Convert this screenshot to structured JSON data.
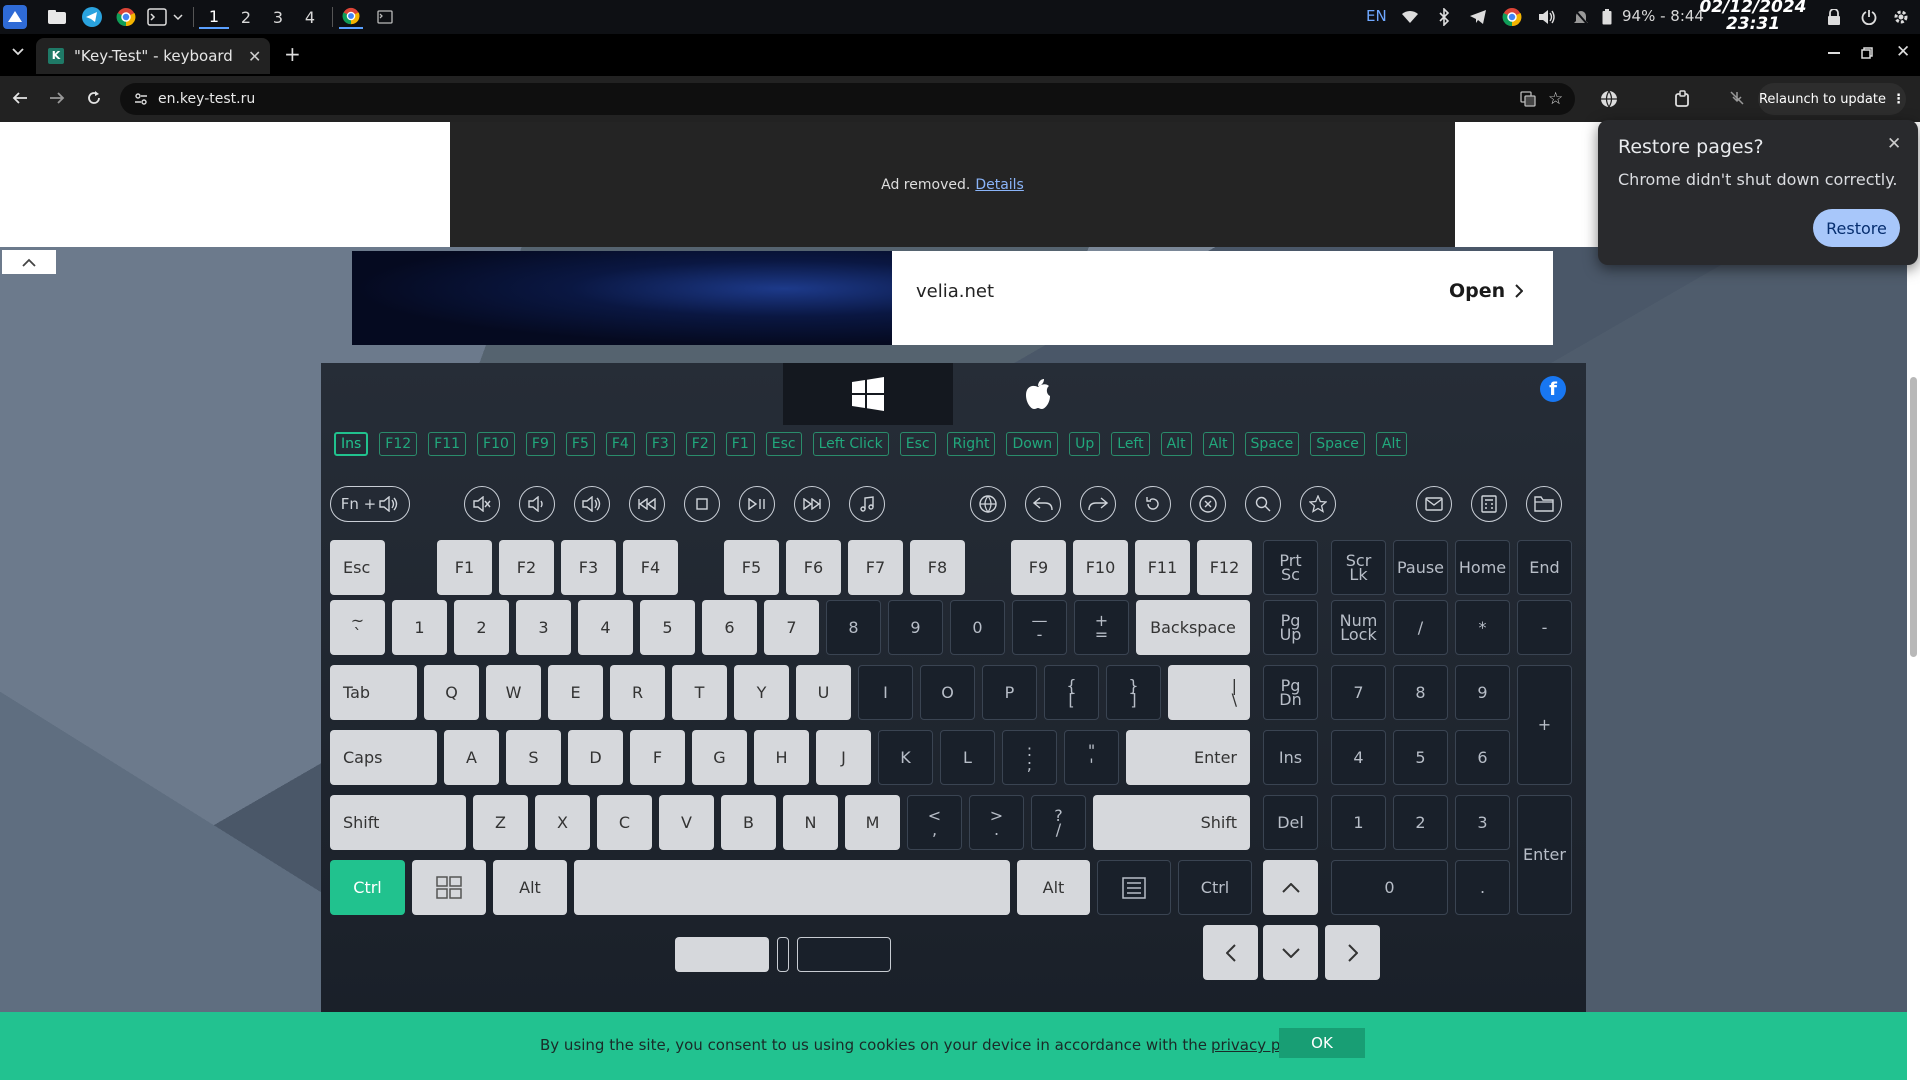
{
  "system_bar": {
    "workspaces": [
      "1",
      "2",
      "3",
      "4"
    ],
    "active_workspace": "1",
    "language": "EN",
    "battery": "94% - 8:44",
    "date": "02/12/2024",
    "time": "23:31"
  },
  "browser": {
    "tab_title": "\"Key-Test\" - keyboard te",
    "tab_favicon_letter": "K",
    "url": "en.key-test.ru",
    "relaunch_label": "Relaunch to update"
  },
  "ad": {
    "removed_text": "Ad removed.",
    "details_link": "Details"
  },
  "banner": {
    "site": "velia.net",
    "open_label": "Open"
  },
  "restore_popup": {
    "title": "Restore pages?",
    "message": "Chrome didn't shut down correctly.",
    "button": "Restore"
  },
  "keyboard": {
    "facebook_letter": "f",
    "history": [
      "Ins",
      "F12",
      "F11",
      "F10",
      "F9",
      "F5",
      "F4",
      "F3",
      "F2",
      "F1",
      "Esc",
      "Left Click",
      "Esc",
      "Right",
      "Down",
      "Up",
      "Left",
      "Alt",
      "Alt",
      "Space",
      "Space",
      "Alt"
    ],
    "fn_label": "Fn +",
    "rows": {
      "esc": "Esc",
      "f": [
        "F1",
        "F2",
        "F3",
        "F4",
        "F5",
        "F6",
        "F7",
        "F8",
        "F9",
        "F10",
        "F11",
        "F12"
      ],
      "prtsc": [
        "Prt",
        "Sc"
      ],
      "scrlk": [
        "Scr",
        "Lk"
      ],
      "pause": "Pause",
      "home": "Home",
      "end": "End",
      "num": [
        "1",
        "2",
        "3",
        "4",
        "5",
        "6",
        "7",
        "8",
        "9",
        "0"
      ],
      "tilde": [
        "~",
        "`"
      ],
      "minus": [
        "—",
        "-"
      ],
      "plus": [
        "+",
        "="
      ],
      "backspace": "Backspace",
      "pgup": [
        "Pg",
        "Up"
      ],
      "numlock": [
        "Num",
        "Lock"
      ],
      "np_div": "/",
      "np_mul": "*",
      "np_sub": "-",
      "tab": "Tab",
      "qrow": [
        "Q",
        "W",
        "E",
        "R",
        "T",
        "Y",
        "U",
        "I",
        "O",
        "P"
      ],
      "lbrace": [
        "{",
        "["
      ],
      "rbrace": [
        "}",
        "]"
      ],
      "pipe": [
        "|",
        "\\"
      ],
      "pgdn": [
        "Pg",
        "Dn"
      ],
      "np7": "7",
      "np8": "8",
      "np9": "9",
      "np_add": "+",
      "caps": "Caps",
      "arow": [
        "A",
        "S",
        "D",
        "F",
        "G",
        "H",
        "J",
        "K",
        "L"
      ],
      "colon": [
        ":",
        ";"
      ],
      "quote": [
        "\"",
        "'"
      ],
      "enter": "Enter",
      "ins": "Ins",
      "np4": "4",
      "np5": "5",
      "np6": "6",
      "shift": "Shift",
      "zrow": [
        "Z",
        "X",
        "C",
        "V",
        "B",
        "N",
        "M"
      ],
      "lt": [
        "<",
        ","
      ],
      "gt": [
        ">",
        "."
      ],
      "q": [
        "?",
        "/"
      ],
      "del": "Del",
      "np1": "1",
      "np2": "2",
      "np3": "3",
      "np_enter": "Enter",
      "ctrl": "Ctrl",
      "alt": "Alt",
      "np0": "0",
      "np_dot": "."
    }
  },
  "cookie": {
    "text": "By using the site, you consent to us using cookies on your device in accordance with the",
    "link": "privacy policy",
    "ok": "OK"
  },
  "colors": {
    "accent": "#21c28e",
    "cookie_bg": "#22c290",
    "restore_btn": "#a8c7fa"
  }
}
